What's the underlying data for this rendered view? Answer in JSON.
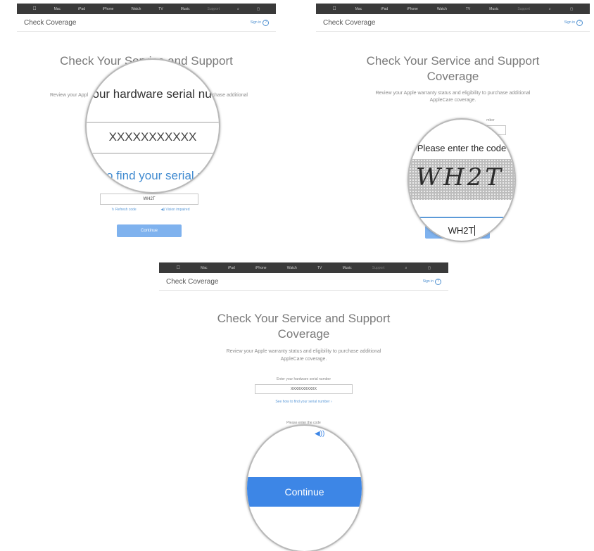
{
  "nav": {
    "apple": "",
    "items": [
      "Mac",
      "iPad",
      "iPhone",
      "Watch",
      "TV",
      "Music",
      "Support"
    ],
    "search": "⌕",
    "bag": "🛍"
  },
  "header": {
    "title": "Check Coverage",
    "sign_in": "Sign in",
    "help": "?"
  },
  "page": {
    "heading": "Check Your Service and Support Coverage",
    "heading_line1": "Check Your Service and Support",
    "heading_line2": "Coverage",
    "desc_line1": "Review your Apple warranty status and eligibility to purchase additional",
    "desc_line2": "AppleCare coverage.",
    "desc_partial_left": "Review your Appl",
    "desc_partial_right": "urchase additional",
    "serial_label": "Enter your hardware serial number",
    "serial_label_partial": "your hardware serial nu",
    "serial_value": "XXXXXXXXXXX",
    "find_serial": "See how to find your serial number ›",
    "find_serial_partial": "v to find your serial n",
    "code_label": "Please enter the code",
    "captcha": "WH2T",
    "code_value": "WH2T",
    "refresh": "Refresh code",
    "vision": "Vision impaired",
    "continue": "Continue",
    "number_partial": "mber",
    "speaker": "◀))"
  },
  "colors": {
    "navbar": "#3a3a3a",
    "accent": "#4d8fd0",
    "button": "#7fb2ee",
    "button_zoom": "#3d86e6"
  }
}
